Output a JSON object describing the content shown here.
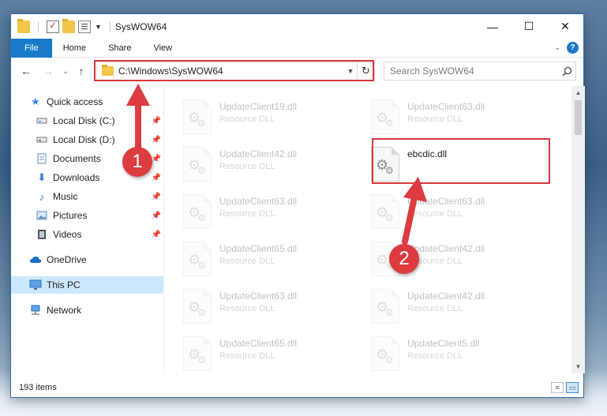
{
  "window": {
    "title": "SysWOW64",
    "minimize_label": "—",
    "maximize_label": "☐",
    "close_label": "✕"
  },
  "ribbon": {
    "tabs": [
      "File",
      "Home",
      "Share",
      "View"
    ],
    "help_label": "?"
  },
  "navigation": {
    "back_label": "←",
    "forward_label": "→",
    "recent_label": "⌄",
    "up_label": "↑",
    "address_path": "C:\\Windows\\SysWOW64",
    "refresh_label": "↻",
    "search_placeholder": "Search SysWOW64"
  },
  "sidebar": {
    "items": [
      {
        "label": "Quick access",
        "icon": "star-icon",
        "pinned": false
      },
      {
        "label": "Local Disk (C:)",
        "icon": "drive-icon",
        "pinned": true
      },
      {
        "label": "Local Disk (D:)",
        "icon": "drive-icon",
        "pinned": true
      },
      {
        "label": "Documents",
        "icon": "documents-icon",
        "pinned": true
      },
      {
        "label": "Downloads",
        "icon": "downloads-icon",
        "pinned": true
      },
      {
        "label": "Music",
        "icon": "music-icon",
        "pinned": true
      },
      {
        "label": "Pictures",
        "icon": "pictures-icon",
        "pinned": true
      },
      {
        "label": "Videos",
        "icon": "videos-icon",
        "pinned": true
      },
      {
        "label": "OneDrive",
        "icon": "cloud-icon",
        "pinned": false
      },
      {
        "label": "This PC",
        "icon": "computer-icon",
        "pinned": false,
        "selected": true
      },
      {
        "label": "Network",
        "icon": "network-icon",
        "pinned": false
      }
    ]
  },
  "files": [
    {
      "name": "UpdateClient19.dll",
      "type": "Resource DLL"
    },
    {
      "name": "UpdateClient63.dll",
      "type": "Resource DLL"
    },
    {
      "name": "UpdateClient42.dll",
      "type": "Resource DLL"
    },
    {
      "name": "ebcdic.dll",
      "type": ""
    },
    {
      "name": "UpdateClient63.dll",
      "type": "Resource DLL"
    },
    {
      "name": "UpdateClient63.dll",
      "type": "Resource DLL"
    },
    {
      "name": "UpdateClient65.dll",
      "type": "Resource DLL"
    },
    {
      "name": "UpdateClient42.dll",
      "type": "Resource DLL"
    },
    {
      "name": "UpdateClient63.dll",
      "type": "Resource DLL"
    },
    {
      "name": "UpdateClient42.dll",
      "type": "Resource DLL"
    },
    {
      "name": "UpdateClient65.dll",
      "type": "Resource DLL"
    },
    {
      "name": "UpdateClient5.dll",
      "type": "Resource DLL"
    }
  ],
  "status": {
    "item_count": "193 items"
  },
  "annotations": {
    "step1": "1",
    "step2": "2",
    "highlight_color": "#d8383e"
  },
  "colors": {
    "accent": "#1979ca",
    "selection": "#cce8ff",
    "annotation": "#dc3b3f"
  }
}
